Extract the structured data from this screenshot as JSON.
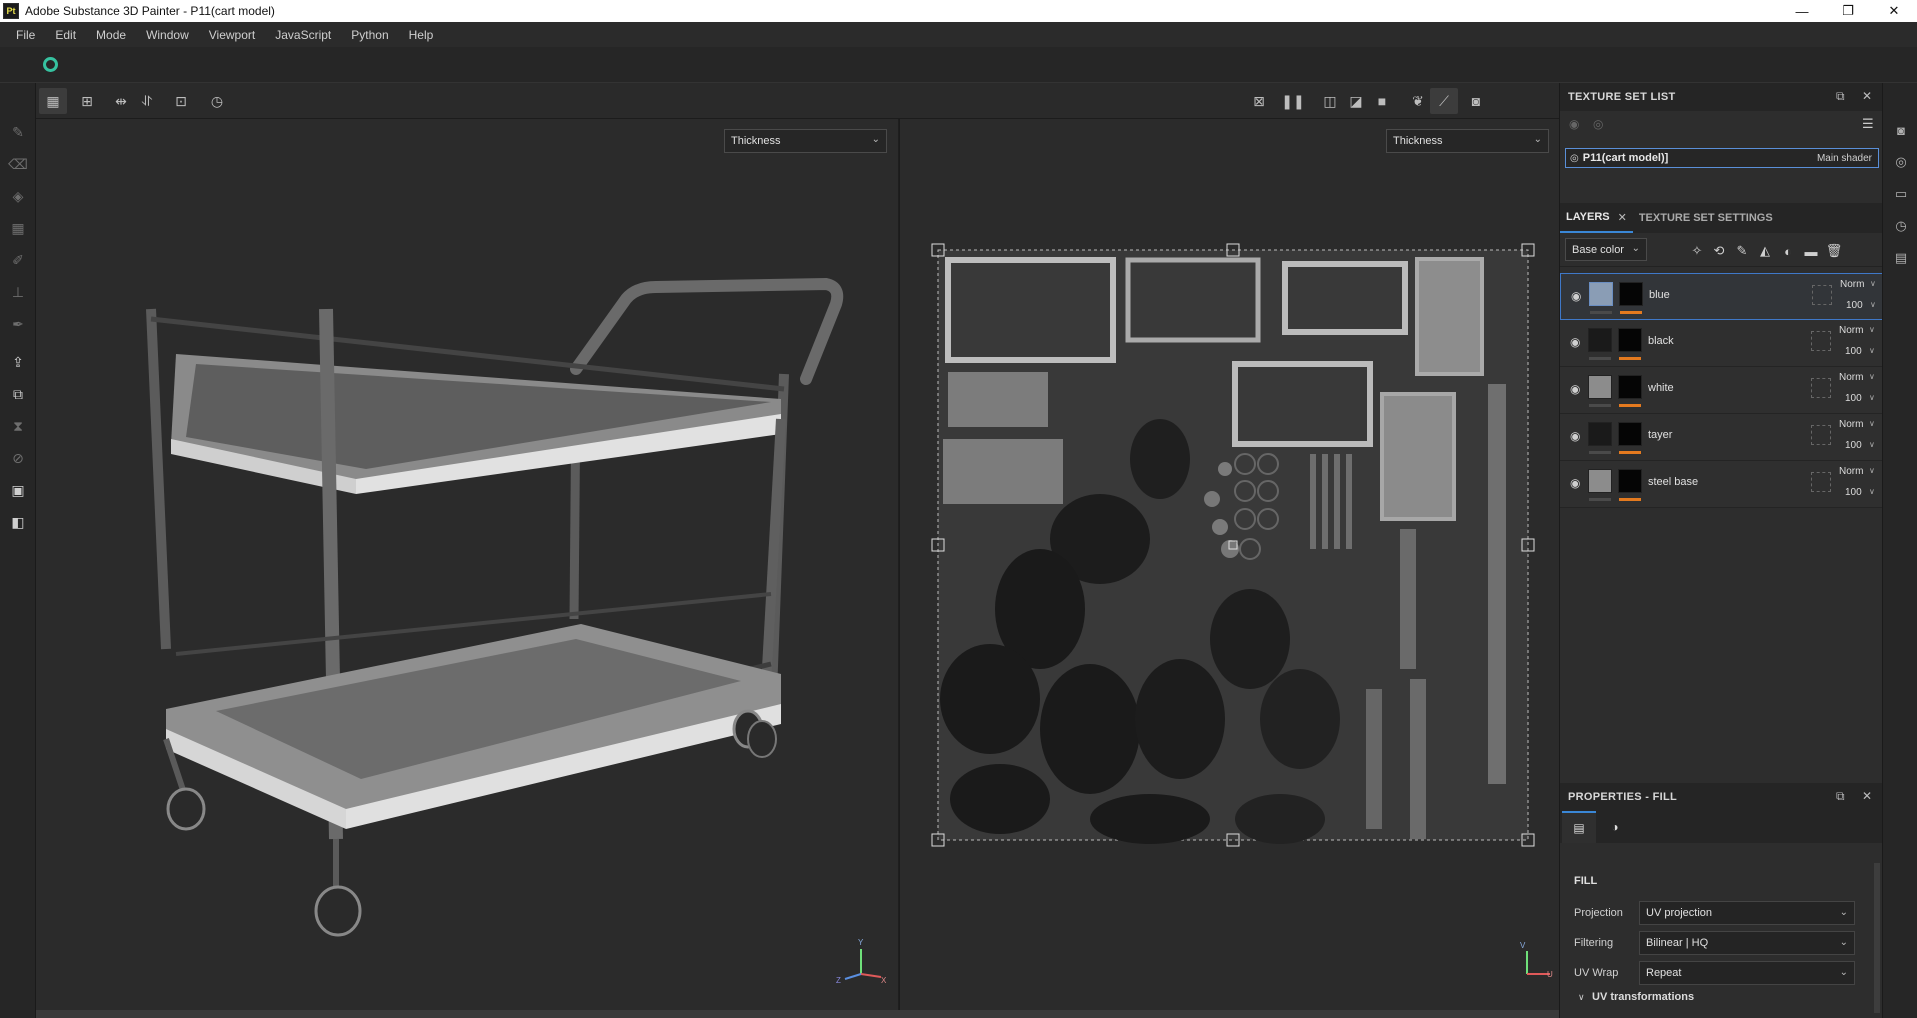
{
  "window": {
    "app_icon": "Pt",
    "title": "Adobe Substance 3D Painter - P11(cart model)",
    "controls": [
      "—",
      "❐",
      "✕"
    ]
  },
  "menu": [
    "File",
    "Edit",
    "Mode",
    "Window",
    "Viewport",
    "JavaScript",
    "Python",
    "Help"
  ],
  "viewport": {
    "left_channel": "Thickness",
    "right_channel": "Thickness",
    "axis_3d": {
      "y": "Y",
      "x": "X",
      "z": "Z"
    },
    "axis_uv": {
      "v": "V",
      "u": "U"
    }
  },
  "texture_set_list": {
    "title": "TEXTURE SET LIST",
    "item_name": "P11(cart model)]",
    "item_shader": "Main shader"
  },
  "layers_panel": {
    "tabs": [
      "LAYERS",
      "TEXTURE SET SETTINGS"
    ],
    "channel": "Base color",
    "layers": [
      {
        "name": "blue",
        "blend": "Norm",
        "opacity": "100",
        "swatch": "#8a9db5",
        "selected": true
      },
      {
        "name": "black",
        "blend": "Norm",
        "opacity": "100",
        "swatch": "#1a1a1a",
        "selected": false
      },
      {
        "name": "white",
        "blend": "Norm",
        "opacity": "100",
        "swatch": "#8c8c8c",
        "selected": false
      },
      {
        "name": "tayer",
        "blend": "Norm",
        "opacity": "100",
        "swatch": "#1a1a1a",
        "selected": false
      },
      {
        "name": "steel base",
        "blend": "Norm",
        "opacity": "100",
        "swatch": "#8c8c8c",
        "selected": false
      }
    ]
  },
  "properties": {
    "title": "PROPERTIES - FILL",
    "section": "FILL",
    "projection_label": "Projection",
    "projection_value": "UV projection",
    "filtering_label": "Filtering",
    "filtering_value": "Bilinear | HQ",
    "uvwrap_label": "UV Wrap",
    "uvwrap_value": "Repeat",
    "uv_transformations": "UV transformations"
  },
  "colors": {
    "accent": "#3a87d6",
    "mask_bar": "#e47a1f",
    "layer_bg": "#2f2f2f"
  }
}
